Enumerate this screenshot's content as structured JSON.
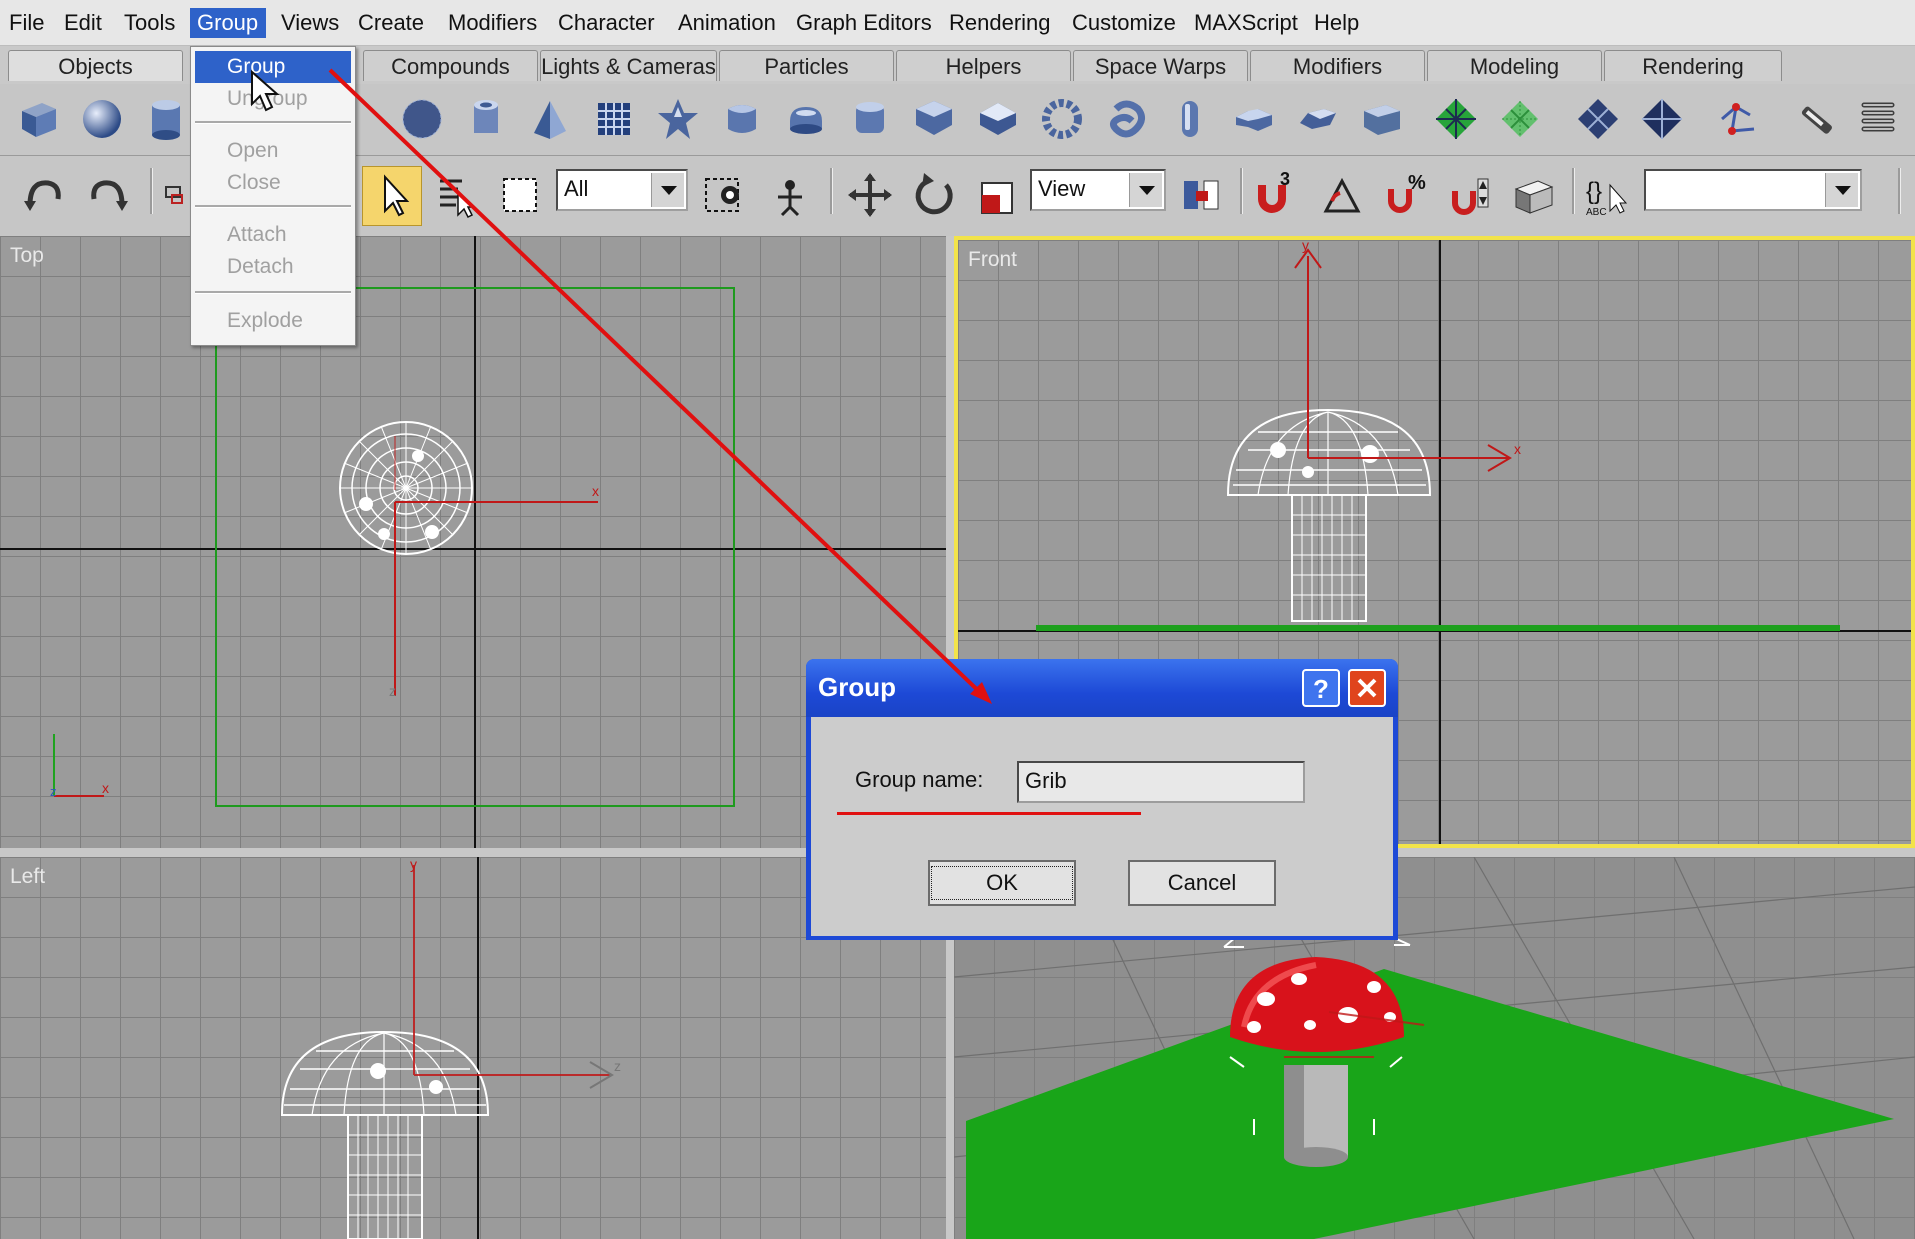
{
  "menubar": [
    "File",
    "Edit",
    "Tools",
    "Group",
    "Views",
    "Create",
    "Modifiers",
    "Character",
    "Animation",
    "Graph Editors",
    "Rendering",
    "Customize",
    "MAXScript",
    "Help"
  ],
  "tabs": [
    "Objects",
    "Compounds",
    "Lights & Cameras",
    "Particles",
    "Helpers",
    "Space Warps",
    "Modifiers",
    "Modeling",
    "Rendering"
  ],
  "group_menu": {
    "items": [
      "Group",
      "Ungroup",
      "Open",
      "Close",
      "Attach",
      "Detach",
      "Explode"
    ]
  },
  "toolbar": {
    "filter_value": "All",
    "coord_value": "View",
    "named_selection_value": ""
  },
  "viewports": {
    "top": "Top",
    "front": "Front",
    "left": "Left"
  },
  "dialog": {
    "title": "Group",
    "field_label": "Group name:",
    "field_value": "Grib",
    "ok": "OK",
    "cancel": "Cancel"
  },
  "colors": {
    "menu_highlight": "#2e62c9",
    "active_viewport_border": "#f2e34a",
    "annotation": "#e01010",
    "ground_plane": "#19a519",
    "mushroom_cap": "#d8121b"
  },
  "icons": [
    "box-icon",
    "sphere-icon",
    "cylinder-icon",
    "geosphere-icon",
    "tube-icon",
    "pyramid-icon",
    "plane-icon",
    "hedra-icon",
    "chamferbox-icon",
    "oiltank-icon",
    "capsule-icon",
    "gengon-icon",
    "prism-icon",
    "torusknot-icon",
    "ringwave-icon",
    "hose-icon",
    "lextrude-icon",
    "cext-icon",
    "terrain-icon",
    "scatter-icon",
    "mesher-icon",
    "bool-icon",
    "wrench-icon",
    "spring-icon"
  ]
}
